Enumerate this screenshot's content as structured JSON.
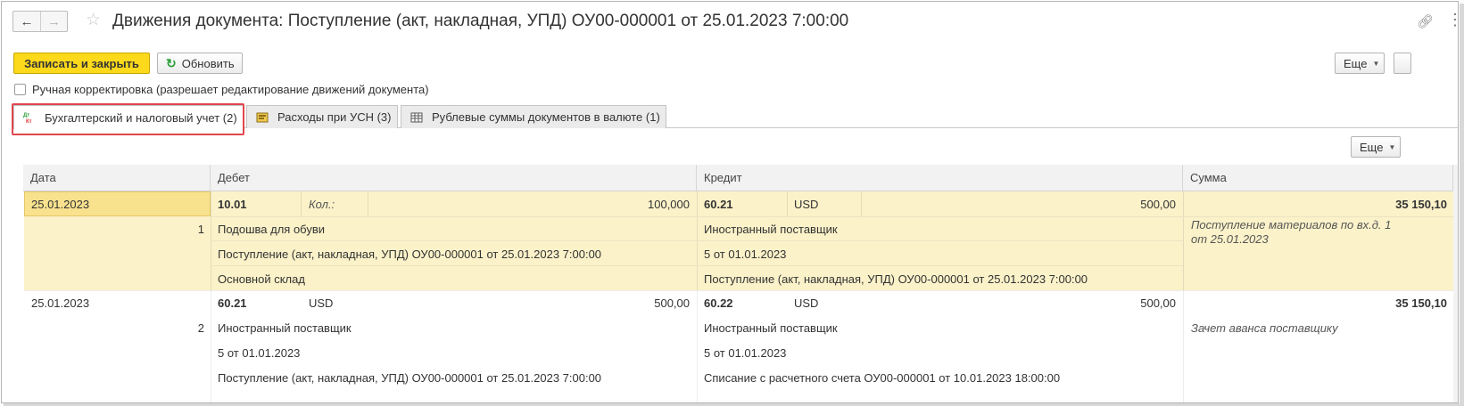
{
  "window": {
    "title": "Движения документа: Поступление (акт, накладная, УПД) ОУ00-000001 от 25.01.2023 7:00:00",
    "back_icon": "arrow-left-icon",
    "forward_icon": "arrow-right-icon",
    "favorite_icon": "star-icon",
    "link_icon": "link-icon",
    "menu_icon": "kebab-menu-icon"
  },
  "toolbar": {
    "save_close_label": "Записать и закрыть",
    "refresh_label": "Обновить",
    "more_label": "Еще",
    "manual_edit_label": "Ручная корректировка (разрешает редактирование движений документа)"
  },
  "tabs": [
    {
      "label": "Бухгалтерский и налоговый учет (2)",
      "icon": "dt-kt-icon",
      "active": true
    },
    {
      "label": "Расходы при УСН (3)",
      "icon": "register-icon",
      "active": false
    },
    {
      "label": "Рублевые суммы документов в валюте (1)",
      "icon": "table-icon",
      "active": false
    }
  ],
  "table": {
    "more_label": "Еще",
    "columns": {
      "date": "Дата",
      "debit": "Дебет",
      "credit": "Кредит",
      "amount": "Сумма"
    },
    "rows": [
      {
        "date": "25.01.2023",
        "line_no": "1",
        "debit_account": "10.01",
        "debit_qty_label": "Кол.:",
        "debit_value": "100,000",
        "debit_sub1": "Подошва для обуви",
        "debit_sub2": "Поступление (акт, накладная, УПД) ОУ00-000001 от 25.01.2023 7:00:00",
        "debit_sub3": "Основной склад",
        "credit_account": "60.21",
        "credit_currency": "USD",
        "credit_value": "500,00",
        "credit_sub1": "Иностранный поставщик",
        "credit_sub2": "5 от 01.01.2023",
        "credit_sub3": "Поступление (акт, накладная, УПД) ОУ00-000001 от 25.01.2023 7:00:00",
        "amount": "35 150,10",
        "comment_line1": "Поступление материалов по вх.д. 1",
        "comment_line2": "от 25.01.2023"
      },
      {
        "date": "25.01.2023",
        "line_no": "2",
        "debit_account": "60.21",
        "debit_currency": "USD",
        "debit_value": "500,00",
        "debit_sub1": "Иностранный поставщик",
        "debit_sub2": "5 от 01.01.2023",
        "debit_sub3": "Поступление (акт, накладная, УПД) ОУ00-000001 от 25.01.2023 7:00:00",
        "credit_account": "60.22",
        "credit_currency": "USD",
        "credit_value": "500,00",
        "credit_sub1": "Иностранный поставщик",
        "credit_sub2": "5 от 01.01.2023",
        "credit_sub3": "Списание с расчетного счета ОУ00-000001 от 10.01.2023 18:00:00",
        "amount": "35 150,10",
        "comment_line1": "Зачет аванса поставщику"
      }
    ]
  },
  "colors": {
    "primary_button": "#fdd91b",
    "selected_row": "#fbf2c9",
    "selected_cell": "#f8e28e",
    "highlight_frame": "#e0474c"
  }
}
